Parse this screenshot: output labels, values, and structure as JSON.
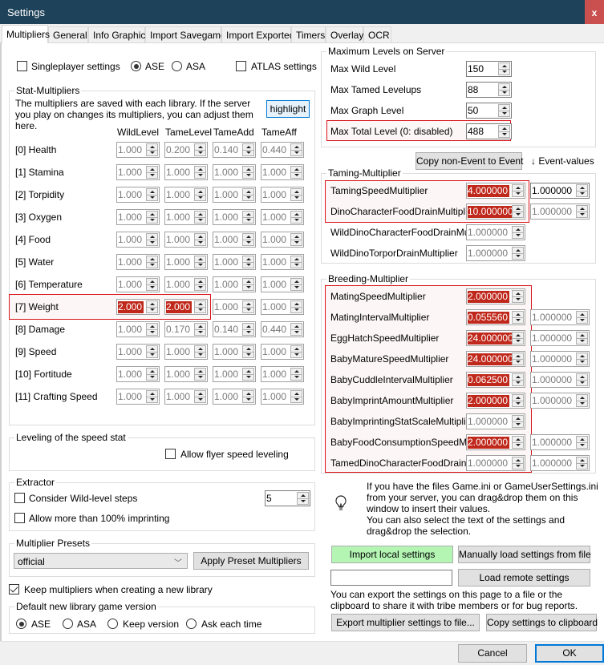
{
  "window": {
    "title": "Settings",
    "close_label": "x"
  },
  "tabs": [
    "Multipliers",
    "General",
    "Info Graphic",
    "Import Savegame",
    "Import Exported",
    "Timers",
    "Overlay",
    "OCR"
  ],
  "active_tab": "Multipliers",
  "top_options": {
    "singleplayer_label": "Singleplayer settings",
    "singleplayer_checked": false,
    "game_options": [
      "ASE",
      "ASA"
    ],
    "game_selected": "ASE",
    "atlas_label": "ATLAS settings",
    "atlas_checked": false
  },
  "stat_multipliers": {
    "legend": "Stat-Multipliers",
    "description": "The multipliers are saved with each library. If the server you play on changes its multipliers, you can adjust them here.",
    "highlight_label": "highlight",
    "columns": [
      "WildLevel",
      "TameLevel",
      "TameAdd",
      "TameAff"
    ],
    "rows": [
      {
        "name": "[0] Health",
        "values": [
          "1.000",
          "0.200",
          "0.140",
          "0.440"
        ],
        "highlighted": [
          false,
          false,
          false,
          false
        ]
      },
      {
        "name": "[1] Stamina",
        "values": [
          "1.000",
          "1.000",
          "1.000",
          "1.000"
        ],
        "highlighted": [
          false,
          false,
          false,
          false
        ]
      },
      {
        "name": "[2] Torpidity",
        "values": [
          "1.000",
          "1.000",
          "1.000",
          "1.000"
        ],
        "highlighted": [
          false,
          false,
          false,
          false
        ]
      },
      {
        "name": "[3] Oxygen",
        "values": [
          "1.000",
          "1.000",
          "1.000",
          "1.000"
        ],
        "highlighted": [
          false,
          false,
          false,
          false
        ]
      },
      {
        "name": "[4] Food",
        "values": [
          "1.000",
          "1.000",
          "1.000",
          "1.000"
        ],
        "highlighted": [
          false,
          false,
          false,
          false
        ]
      },
      {
        "name": "[5] Water",
        "values": [
          "1.000",
          "1.000",
          "1.000",
          "1.000"
        ],
        "highlighted": [
          false,
          false,
          false,
          false
        ]
      },
      {
        "name": "[6] Temperature",
        "values": [
          "1.000",
          "1.000",
          "1.000",
          "1.000"
        ],
        "highlighted": [
          false,
          false,
          false,
          false
        ]
      },
      {
        "name": "[7] Weight",
        "values": [
          "2.000",
          "2.000",
          "1.000",
          "1.000"
        ],
        "highlighted": [
          true,
          true,
          false,
          false
        ]
      },
      {
        "name": "[8] Damage",
        "values": [
          "1.000",
          "0.170",
          "0.140",
          "0.440"
        ],
        "highlighted": [
          false,
          false,
          false,
          false
        ]
      },
      {
        "name": "[9] Speed",
        "values": [
          "1.000",
          "1.000",
          "1.000",
          "1.000"
        ],
        "highlighted": [
          false,
          false,
          false,
          false
        ]
      },
      {
        "name": "[10] Fortitude",
        "values": [
          "1.000",
          "1.000",
          "1.000",
          "1.000"
        ],
        "highlighted": [
          false,
          false,
          false,
          false
        ]
      },
      {
        "name": "[11] Crafting Speed",
        "values": [
          "1.000",
          "1.000",
          "1.000",
          "1.000"
        ],
        "highlighted": [
          false,
          false,
          false,
          false
        ]
      }
    ]
  },
  "speed_leveling": {
    "legend": "Leveling of the speed stat",
    "flyer_label": "Allow flyer speed leveling",
    "flyer_checked": false
  },
  "extractor": {
    "legend": "Extractor",
    "wild_steps_label": "Consider Wild-level steps",
    "wild_steps_checked": false,
    "wild_steps_value": "5",
    "imprinting_label": "Allow more than 100% imprinting",
    "imprinting_checked": false
  },
  "presets": {
    "legend": "Multiplier Presets",
    "selected": "official",
    "apply_label": "Apply Preset Multipliers"
  },
  "keep_multipliers": {
    "label": "Keep multipliers when creating a new library",
    "checked": true
  },
  "default_version": {
    "legend": "Default new library game version",
    "options": [
      "ASE",
      "ASA",
      "Keep version",
      "Ask each time"
    ],
    "selected": "ASE"
  },
  "max_levels": {
    "legend": "Maximum Levels on Server",
    "rows": [
      {
        "label": "Max Wild Level",
        "value": "150"
      },
      {
        "label": "Max Tamed Levelups",
        "value": "88"
      },
      {
        "label": "Max Graph Level",
        "value": "50"
      },
      {
        "label": "Max Total Level (0: disabled)",
        "value": "488",
        "highlighted": true
      }
    ]
  },
  "copy_event_label": "Copy non-Event to Event",
  "event_values_label": "↓ Event-values",
  "taming": {
    "legend": "Taming-Multiplier",
    "rows": [
      {
        "label": "TamingSpeedMultiplier",
        "value": "4.000000",
        "event": "1.000000",
        "highlighted": true,
        "event_enabled": true
      },
      {
        "label": "DinoCharacterFoodDrainMultiplier",
        "value": "10.000000",
        "event": "1.000000",
        "highlighted": true,
        "event_enabled": false
      },
      {
        "label": "WildDinoCharacterFoodDrainMultipli",
        "value": "1.000000",
        "event": null,
        "highlighted": false
      },
      {
        "label": "WildDinoTorporDrainMultiplier",
        "value": "1.000000",
        "event": null,
        "highlighted": false
      }
    ]
  },
  "breeding": {
    "legend": "Breeding-Multiplier",
    "rows": [
      {
        "label": "MatingSpeedMultiplier",
        "value": "2.000000",
        "event": null,
        "highlighted": true
      },
      {
        "label": "MatingIntervalMultiplier",
        "value": "0.055560",
        "event": "1.000000",
        "highlighted": true
      },
      {
        "label": "EggHatchSpeedMultiplier",
        "value": "24.000000",
        "event": "1.000000",
        "highlighted": true
      },
      {
        "label": "BabyMatureSpeedMultiplier",
        "value": "24.000000",
        "event": "1.000000",
        "highlighted": true
      },
      {
        "label": "BabyCuddleIntervalMultiplier",
        "value": "0.062500",
        "event": "1.000000",
        "highlighted": true
      },
      {
        "label": "BabyImprintAmountMultiplier",
        "value": "2.000000",
        "event": "1.000000",
        "highlighted": true
      },
      {
        "label": "BabyImprintingStatScaleMultiplier",
        "value": "1.000000",
        "event": null,
        "highlighted": false
      },
      {
        "label": "BabyFoodConsumptionSpeedMult",
        "value": "2.000000",
        "event": "1.000000",
        "highlighted": true
      },
      {
        "label": "TamedDinoCharacterFoodDrainMult",
        "value": "1.000000",
        "event": "1.000000",
        "highlighted": false
      }
    ]
  },
  "import_info": "If you have the files Game.ini or GameUserSettings.ini from your server, you can drag&drop them on this window to insert their values.\nYou can also select the text of the settings and drag&drop the selection.",
  "import_local_label": "Import local settings",
  "manual_load_label": "Manually load settings from file",
  "remote_url_value": "",
  "load_remote_label": "Load remote settings",
  "export_info": "You can export the settings on this page to a file or the clipboard to share it with tribe members or for bug reports.",
  "export_file_label": "Export multiplier settings to file...",
  "copy_clipboard_label": "Copy settings to clipboard",
  "footer": {
    "cancel_label": "Cancel",
    "ok_label": "OK"
  },
  "colors": {
    "highlight_bg": "#c0281b",
    "highlight_border": "#d9141a",
    "title_bar": "#1e4259",
    "import_local_bg": "#b4f5b4"
  }
}
